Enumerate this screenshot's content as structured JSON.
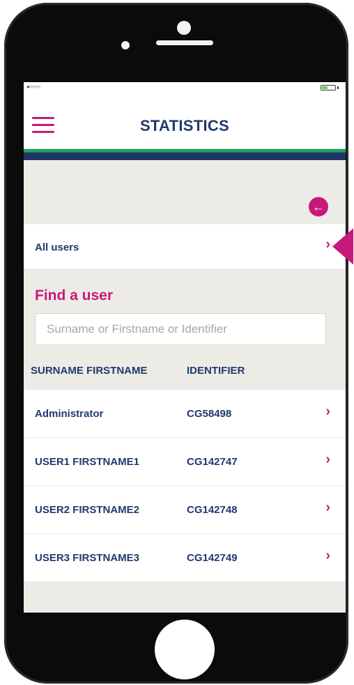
{
  "status_bar": {
    "signal": "●○○○○"
  },
  "header": {
    "title": "STATISTICS"
  },
  "all_users": {
    "label": "All users"
  },
  "find_user": {
    "title": "Find a user",
    "placeholder": "Surname or Firstname or Identifier",
    "value": ""
  },
  "table": {
    "columns": [
      "SURNAME FIRSTNAME",
      "IDENTIFIER"
    ],
    "rows": [
      {
        "name": "Administrator",
        "identifier": "CG58498"
      },
      {
        "name": "USER1 FIRSTNAME1",
        "identifier": "CG142747"
      },
      {
        "name": "USER2 FIRSTNAME2",
        "identifier": "CG142748"
      },
      {
        "name": "USER3 FIRSTNAME3",
        "identifier": "CG142749"
      }
    ]
  },
  "icons": {
    "menu": "hamburger-menu-icon",
    "back": "back-arrow-icon",
    "chevron": "chevron-right-icon",
    "pointer": "pointer-arrow-icon"
  },
  "colors": {
    "accent": "#c8187c",
    "navy": "#1f3a6e",
    "green": "#1fa35f"
  }
}
